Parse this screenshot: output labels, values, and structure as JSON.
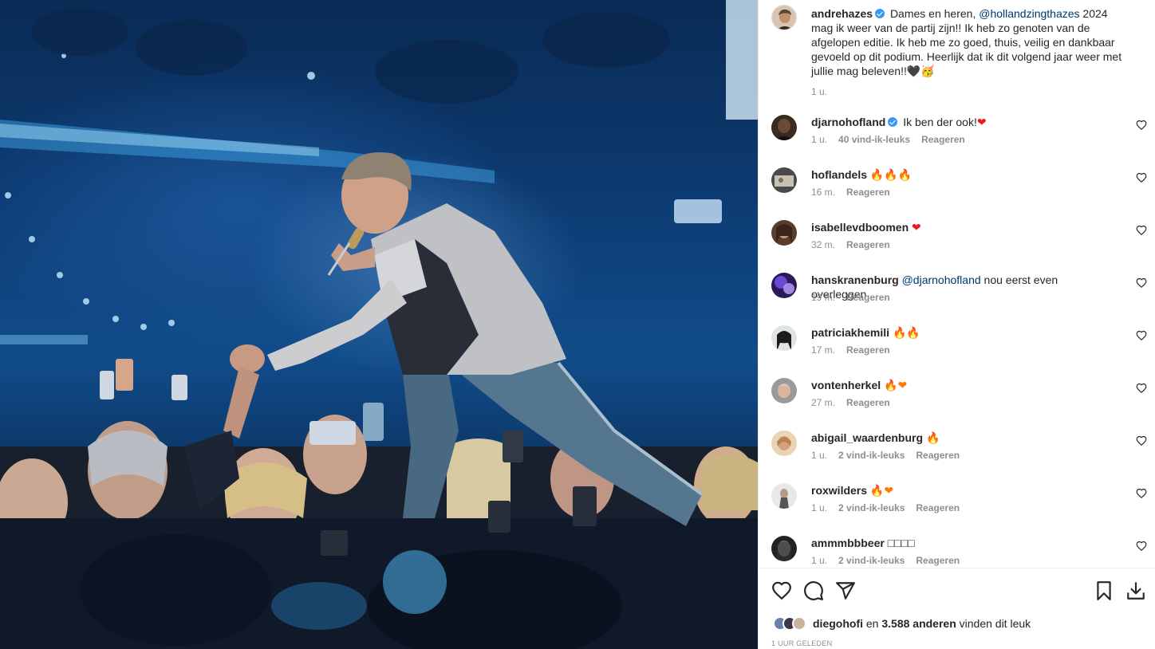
{
  "post": {
    "author": "andrehazes",
    "caption_before": "Dames en heren, ",
    "caption_mention": "@hollandzingthazes",
    "caption_after": " 2024 mag ik weer van de partij zijn!! Ik heb zo genoten van de afgelopen editie. Ik heb me zo goed, thuis, veilig en dankbaar gevoeld op dit podium. Heerlijk dat ik dit volgend jaar weer met jullie mag beleven!!",
    "caption_emoji_1": "🖤",
    "caption_emoji_2": "🥳",
    "time": "1 u."
  },
  "comments": [
    {
      "user": "djarnohofland",
      "verified": true,
      "text": "Ik ben der ook!",
      "emoji": "❤",
      "time": "1 u.",
      "likes": "40 vind-ik-leuks",
      "reply": "Reageren"
    },
    {
      "user": "hoflandels",
      "text": "",
      "emoji": "🔥🔥🔥",
      "time": "16 m.",
      "likes": "",
      "reply": "Reageren"
    },
    {
      "user": "isabellevdboomen",
      "text": "",
      "emoji": "❤",
      "time": "32 m.",
      "likes": "",
      "reply": "Reageren"
    },
    {
      "user": "hanskranenburg",
      "mention": "@djarnohofland",
      "text": " nou eerst even overleggen",
      "emoji": "",
      "time": "19 m.",
      "likes": "",
      "reply": "Reageren"
    },
    {
      "user": "patriciakhemili",
      "text": "",
      "emoji": "🔥🔥",
      "time": "17 m.",
      "likes": "",
      "reply": "Reageren"
    },
    {
      "user": "vontenherkel",
      "text": "",
      "emoji": "🔥❤",
      "time": "27 m.",
      "likes": "",
      "reply": "Reageren"
    },
    {
      "user": "abigail_waardenburg",
      "text": "",
      "emoji": "🔥",
      "time": "1 u.",
      "likes": "2 vind-ik-leuks",
      "reply": "Reageren"
    },
    {
      "user": "roxwilders",
      "text": "",
      "emoji": "🔥❤",
      "time": "1 u.",
      "likes": "2 vind-ik-leuks",
      "reply": "Reageren"
    },
    {
      "user": "ammmbbbeer",
      "text": "□□□□",
      "emoji": "",
      "time": "1 u.",
      "likes": "2 vind-ik-leuks",
      "reply": "Reageren"
    }
  ],
  "likes": {
    "user": "diegohofi",
    "middle": " en ",
    "count": "3.588 anderen",
    "suffix": " vinden dit leuk"
  },
  "date": "1 UUR GELEDEN",
  "icons": {
    "like": "heart-outline-icon",
    "comment": "comment-bubble-icon",
    "share": "paper-plane-icon",
    "save": "bookmark-icon",
    "download": "download-icon",
    "comment_like": "small-heart-icon"
  }
}
